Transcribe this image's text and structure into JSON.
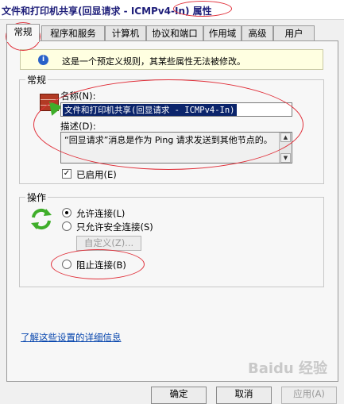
{
  "window": {
    "title": "文件和打印机共享(回显请求 - ICMPv4-In) 属性"
  },
  "tabs": [
    {
      "label": "常规"
    },
    {
      "label": "程序和服务"
    },
    {
      "label": "计算机"
    },
    {
      "label": "协议和端口"
    },
    {
      "label": "作用域"
    },
    {
      "label": "高级"
    },
    {
      "label": "用户"
    }
  ],
  "info": {
    "text": "这是一个预定义规则，其某些属性无法被修改。"
  },
  "general": {
    "group_label": "常规",
    "name_label": "名称(N):",
    "name_value": "文件和打印机共享(回显请求 - ICMPv4-In)",
    "desc_label": "描述(D):",
    "desc_value": "“回显请求”消息是作为 Ping 请求发送到其他节点的。",
    "enabled_label": "已启用(E)",
    "enabled_check": "✓"
  },
  "action": {
    "group_label": "操作",
    "allow_label": "允许连接(L)",
    "allow_secure_label": "只允许安全连接(S)",
    "customize_label": "自定义(Z)...",
    "block_label": "阻止连接(B)"
  },
  "footer": {
    "link": "了解这些设置的详细信息",
    "ok": "确定",
    "cancel": "取消",
    "apply": "应用(A)"
  },
  "watermark": "Baidu 经验",
  "colors": {
    "annotation": "#e0303a",
    "selection": "#0b246b",
    "link": "#0645ad",
    "info_bg": "#ffffe1"
  }
}
